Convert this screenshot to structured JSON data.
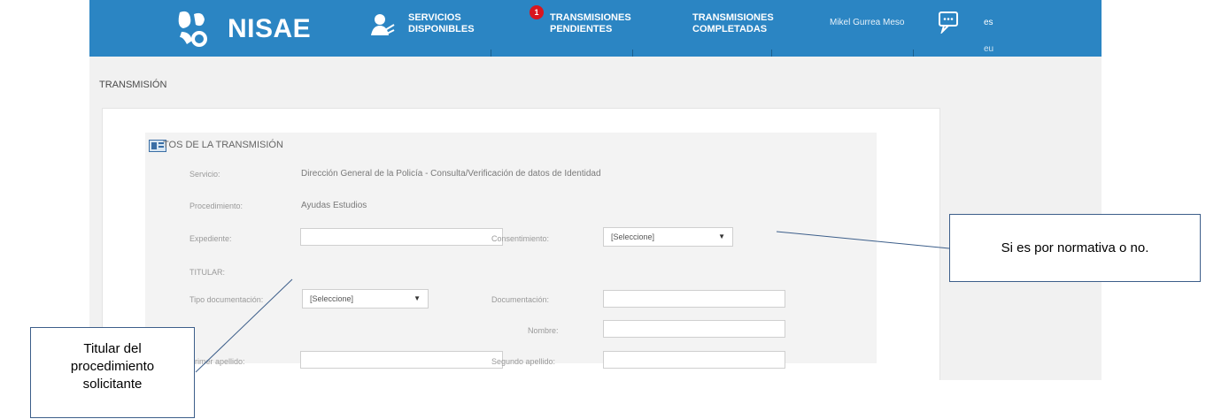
{
  "app": {
    "logo_text": "NISAE",
    "nav": [
      {
        "line1": "SERVICIOS",
        "line2": "DISPONIBLES"
      },
      {
        "line1": "TRANSMISIONES",
        "line2": "PENDIENTES",
        "badge": "1"
      },
      {
        "line1": "TRANSMISIONES",
        "line2": "COMPLETADAS"
      }
    ],
    "user_name": "Mikel Gurrea Meso",
    "languages": [
      "es",
      "eu"
    ],
    "colors": {
      "topbar": "#2b85c3",
      "badge": "#d9161e",
      "callout_border": "#3c5e8a"
    }
  },
  "page": {
    "title": "TRANSMISIÓN",
    "panel_title": "TOS DE LA TRANSMISIÓN",
    "servicio_label": "Servicio:",
    "servicio_value": "Dirección General de la Policía - Consulta/Verificación de datos de Identidad",
    "procedimiento_label": "Procedimiento:",
    "procedimiento_value": "Ayudas Estudios",
    "expediente_label": "Expediente:",
    "expediente_value": "",
    "consentimiento_label": "Consentimiento:",
    "consentimiento_value": "[Seleccione]",
    "titular_label": "TITULAR:",
    "tipo_doc_label": "Tipo documentación:",
    "tipo_doc_value": "[Seleccione]",
    "documentacion_label": "Documentación:",
    "documentacion_value": "",
    "nombre_label": "Nombre:",
    "nombre_value": "",
    "primer_apellido_label": "Primer apellido:",
    "primer_apellido_value": "",
    "segundo_apellido_label": "Segundo apellido:",
    "segundo_apellido_value": ""
  },
  "callouts": {
    "right": "Si es por normativa o no.",
    "left_line1": "Titular del",
    "left_line2": "procedimiento",
    "left_line3": "solicitante"
  }
}
